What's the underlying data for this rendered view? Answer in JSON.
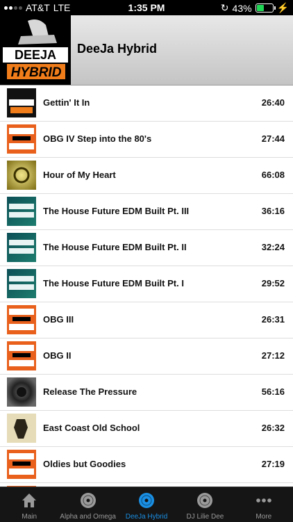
{
  "status_bar": {
    "carrier": "AT&T",
    "network": "LTE",
    "time": "1:35 PM",
    "battery": "43%"
  },
  "header": {
    "title": "DeeJa Hybrid",
    "logo_text_top": "DEEJA",
    "logo_text_bottom": "HYBRID"
  },
  "tracks": [
    {
      "title": "Gettin' It In",
      "duration": "26:40",
      "thumb": "deeja"
    },
    {
      "title": "OBG IV Step into the 80's",
      "duration": "27:44",
      "thumb": "oldies"
    },
    {
      "title": "Hour of My Heart",
      "duration": "66:08",
      "thumb": "gold"
    },
    {
      "title": "The House Future EDM Built Pt. III",
      "duration": "36:16",
      "thumb": "future"
    },
    {
      "title": "The House Future EDM Built Pt. II",
      "duration": "32:24",
      "thumb": "future"
    },
    {
      "title": "The House Future EDM Built Pt. I",
      "duration": "29:52",
      "thumb": "future"
    },
    {
      "title": "OBG III",
      "duration": "26:31",
      "thumb": "oldies"
    },
    {
      "title": "OBG II",
      "duration": "27:12",
      "thumb": "oldies"
    },
    {
      "title": "Release The Pressure",
      "duration": "56:16",
      "thumb": "speaker"
    },
    {
      "title": "East Coast Old School",
      "duration": "26:32",
      "thumb": "eastcoast"
    },
    {
      "title": "Oldies but Goodies",
      "duration": "27:19",
      "thumb": "oldies"
    },
    {
      "title": "",
      "duration": "",
      "thumb": "oldies"
    }
  ],
  "tabs": [
    {
      "label": "Main",
      "icon": "home-icon",
      "active": false
    },
    {
      "label": "Alpha and Omega",
      "icon": "disc-icon",
      "active": false
    },
    {
      "label": "DeeJa Hybrid",
      "icon": "disc-icon",
      "active": true
    },
    {
      "label": "DJ Lilie Dee",
      "icon": "disc-icon",
      "active": false
    },
    {
      "label": "More",
      "icon": "more-icon",
      "active": false
    }
  ],
  "colors": {
    "accent": "#1a8fe3",
    "oldies": "#e8601c",
    "logo_orange": "#f07d1a"
  }
}
